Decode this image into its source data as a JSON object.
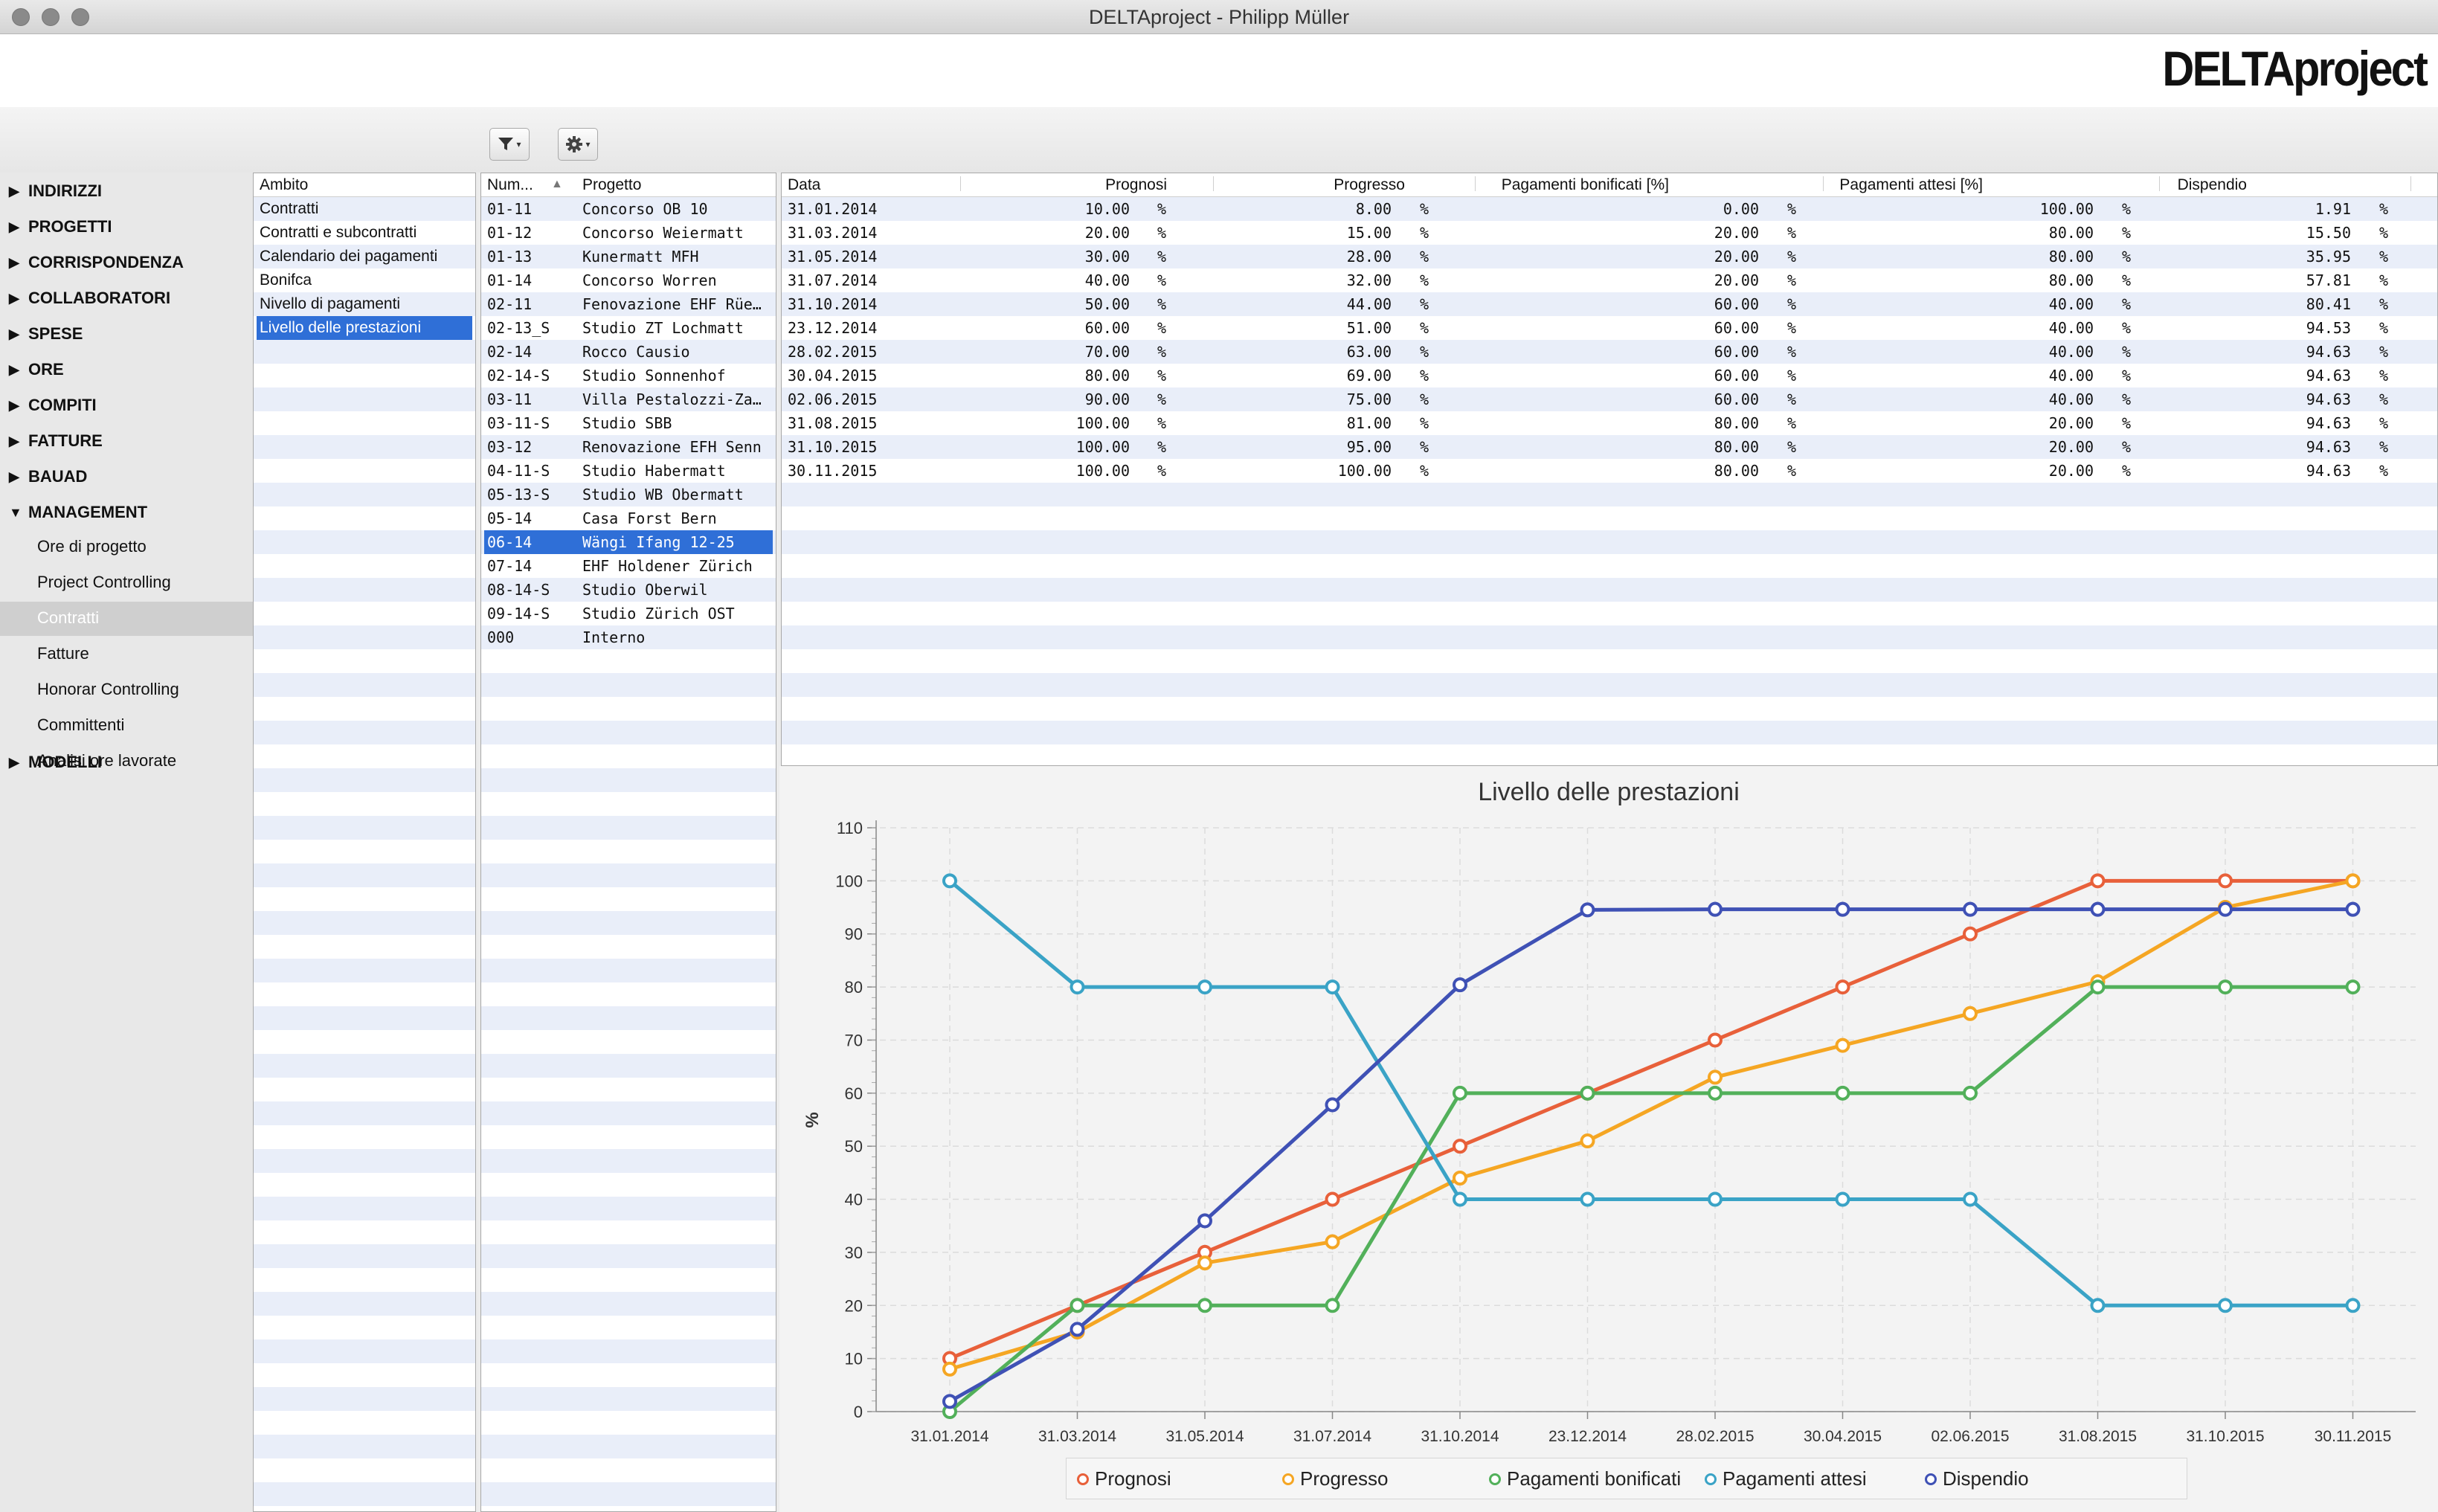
{
  "window": {
    "title": "DELTAproject - Philipp Müller"
  },
  "header": {
    "logo_text": "DELTAproject"
  },
  "toolbar": {
    "filter_icon": "filter-icon",
    "settings_icon": "gear-icon"
  },
  "nav": {
    "groups": [
      {
        "label": "INDIRIZZI",
        "expanded": false
      },
      {
        "label": "PROGETTI",
        "expanded": false
      },
      {
        "label": "CORRISPONDENZA",
        "expanded": false
      },
      {
        "label": "COLLABORATORI",
        "expanded": false
      },
      {
        "label": "SPESE",
        "expanded": false
      },
      {
        "label": "ORE",
        "expanded": false
      },
      {
        "label": "COMPITI",
        "expanded": false
      },
      {
        "label": "FATTURE",
        "expanded": false
      },
      {
        "label": "BAUAD",
        "expanded": false
      },
      {
        "label": "MANAGEMENT",
        "expanded": true
      },
      {
        "label": "MODELLI",
        "expanded": false
      }
    ],
    "management_items": [
      "Ore di progetto",
      "Project Controlling",
      "Contratti",
      "Fatture",
      "Honorar Controlling",
      "Committenti",
      "Analisi ore lavorate"
    ],
    "selected_item": "Contratti"
  },
  "ambito": {
    "header": "Ambito",
    "items": [
      "Contratti",
      "Contratti e subcontratti",
      "Calendario dei pagamenti",
      "Bonifca",
      "Nivello di pagamenti",
      "Livello delle prestazioni"
    ],
    "selected": "Livello delle prestazioni"
  },
  "projects": {
    "headers": {
      "num": "Num...",
      "name": "Progetto"
    },
    "sort_icon": "sort-ascending-icon",
    "rows": [
      {
        "num": "01-11",
        "name": "Concorso OB 10"
      },
      {
        "num": "01-12",
        "name": "Concorso Weiermatt"
      },
      {
        "num": "01-13",
        "name": "Kunermatt MFH"
      },
      {
        "num": "01-14",
        "name": "Concorso Worren"
      },
      {
        "num": "02-11",
        "name": "Fenovazione EHF Rüe..."
      },
      {
        "num": "02-13_S",
        "name": "Studio ZT Lochmatt"
      },
      {
        "num": "02-14",
        "name": "Rocco Causio"
      },
      {
        "num": "02-14-S",
        "name": "Studio  Sonnenhof"
      },
      {
        "num": "03-11",
        "name": "Villa Pestalozzi-Zang..."
      },
      {
        "num": "03-11-S",
        "name": "Studio SBB"
      },
      {
        "num": "03-12",
        "name": "Renovazione EFH Senn"
      },
      {
        "num": "04-11-S",
        "name": "Studio Habermatt"
      },
      {
        "num": "05-13-S",
        "name": "Studio WB Obermatt"
      },
      {
        "num": "05-14",
        "name": "Casa Forst Bern"
      },
      {
        "num": "06-14",
        "name": "Wängi Ifang 12-25"
      },
      {
        "num": "07-14",
        "name": "EHF Holdener Zürich"
      },
      {
        "num": "08-14-S",
        "name": "Studio Oberwil"
      },
      {
        "num": "09-14-S",
        "name": "Studio Zürich OST"
      },
      {
        "num": "000",
        "name": "Interno"
      }
    ],
    "selected_index": 14
  },
  "table": {
    "headers": [
      "Data",
      "Prognosi",
      "Progresso",
      "Pagamenti bonificati [%]",
      "Pagamenti attesi [%]",
      "Dispendio"
    ],
    "unit": "%",
    "rows": [
      [
        "31.01.2014",
        "10.00",
        "8.00",
        "0.00",
        "100.00",
        "1.91"
      ],
      [
        "31.03.2014",
        "20.00",
        "15.00",
        "20.00",
        "80.00",
        "15.50"
      ],
      [
        "31.05.2014",
        "30.00",
        "28.00",
        "20.00",
        "80.00",
        "35.95"
      ],
      [
        "31.07.2014",
        "40.00",
        "32.00",
        "20.00",
        "80.00",
        "57.81"
      ],
      [
        "31.10.2014",
        "50.00",
        "44.00",
        "60.00",
        "40.00",
        "80.41"
      ],
      [
        "23.12.2014",
        "60.00",
        "51.00",
        "60.00",
        "40.00",
        "94.53"
      ],
      [
        "28.02.2015",
        "70.00",
        "63.00",
        "60.00",
        "40.00",
        "94.63"
      ],
      [
        "30.04.2015",
        "80.00",
        "69.00",
        "60.00",
        "40.00",
        "94.63"
      ],
      [
        "02.06.2015",
        "90.00",
        "75.00",
        "60.00",
        "40.00",
        "94.63"
      ],
      [
        "31.08.2015",
        "100.00",
        "81.00",
        "80.00",
        "20.00",
        "94.63"
      ],
      [
        "31.10.2015",
        "100.00",
        "95.00",
        "80.00",
        "20.00",
        "94.63"
      ],
      [
        "30.11.2015",
        "100.00",
        "100.00",
        "80.00",
        "20.00",
        "94.63"
      ]
    ]
  },
  "chart_data": {
    "type": "line",
    "title": "Livello delle prestazioni",
    "xlabel": "",
    "ylabel": "%",
    "ylim": [
      0,
      110
    ],
    "yticks": [
      0,
      10,
      20,
      30,
      40,
      50,
      60,
      70,
      80,
      90,
      100,
      110
    ],
    "grid": true,
    "legend_position": "bottom",
    "categories": [
      "31.01.2014",
      "31.03.2014",
      "31.05.2014",
      "31.07.2014",
      "31.10.2014",
      "23.12.2014",
      "28.02.2015",
      "30.04.2015",
      "02.06.2015",
      "31.08.2015",
      "31.10.2015",
      "30.11.2015"
    ],
    "series": [
      {
        "name": "Prognosi",
        "color": "#e8603a",
        "values": [
          10,
          20,
          30,
          40,
          50,
          60,
          70,
          80,
          90,
          100,
          100,
          100
        ]
      },
      {
        "name": "Progresso",
        "color": "#f5a623",
        "values": [
          8,
          15,
          28,
          32,
          44,
          51,
          63,
          69,
          75,
          81,
          95,
          100
        ]
      },
      {
        "name": "Pagamenti bonificati",
        "color": "#52b05a",
        "values": [
          0,
          20,
          20,
          20,
          60,
          60,
          60,
          60,
          60,
          80,
          80,
          80
        ]
      },
      {
        "name": "Pagamenti attesi",
        "color": "#3aa3c6",
        "values": [
          100,
          80,
          80,
          80,
          40,
          40,
          40,
          40,
          40,
          20,
          20,
          20
        ]
      },
      {
        "name": "Dispendio",
        "color": "#3f51b5",
        "values": [
          1.91,
          15.5,
          35.95,
          57.81,
          80.41,
          94.53,
          94.63,
          94.63,
          94.63,
          94.63,
          94.63,
          94.63
        ]
      }
    ]
  }
}
